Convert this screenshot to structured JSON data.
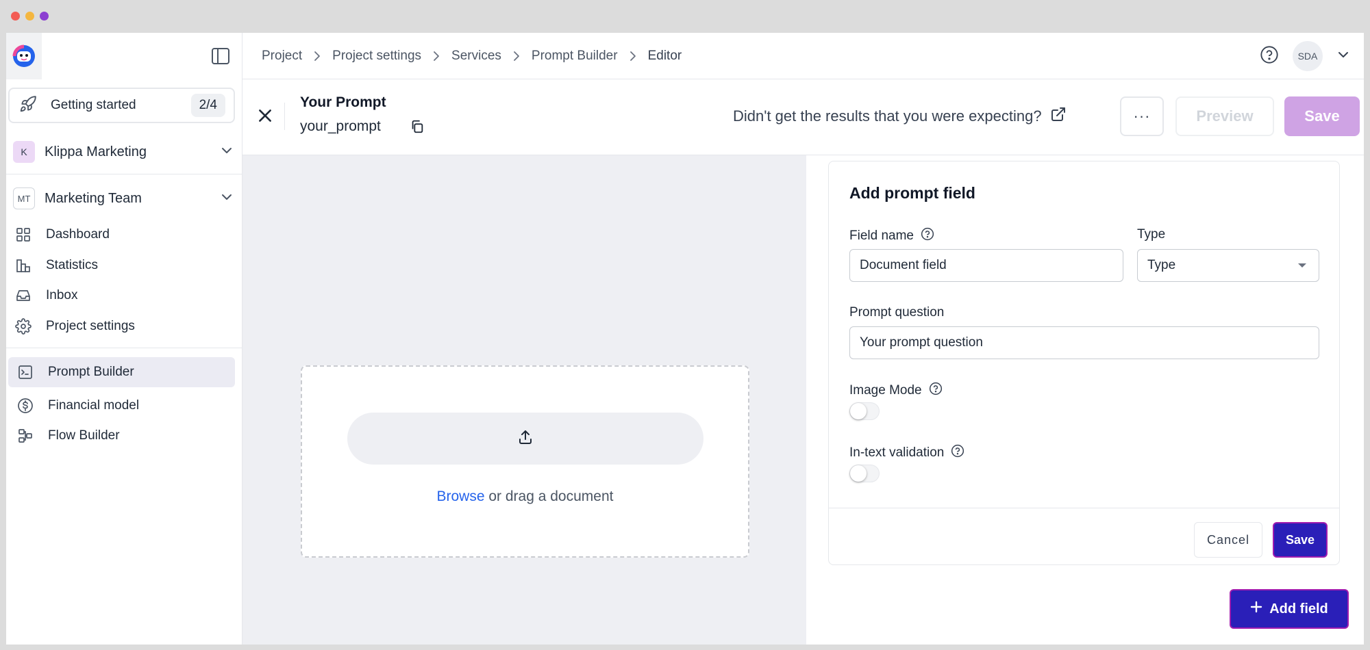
{
  "window": {
    "traffic_colors": [
      "#f25c54",
      "#f4b63f",
      "#8c3fd1"
    ]
  },
  "sidebar": {
    "getting_started": {
      "label": "Getting started",
      "progress": "2/4"
    },
    "organization": {
      "initial": "K",
      "name": "Klippa Marketing",
      "badge_color": "#e9d5f5"
    },
    "team": {
      "initial": "MT",
      "name": "Marketing Team"
    },
    "nav": [
      {
        "label": "Dashboard",
        "icon": "grid-icon"
      },
      {
        "label": "Statistics",
        "icon": "bar-chart-icon"
      },
      {
        "label": "Inbox",
        "icon": "inbox-icon"
      },
      {
        "label": "Project settings",
        "icon": "gear-icon"
      }
    ],
    "nav2": [
      {
        "label": "Prompt Builder",
        "icon": "terminal-icon",
        "active": true
      },
      {
        "label": "Financial model",
        "icon": "dollar-icon"
      },
      {
        "label": "Flow Builder",
        "icon": "flow-icon"
      }
    ]
  },
  "topbar": {
    "breadcrumb": [
      "Project",
      "Project settings",
      "Services",
      "Prompt Builder",
      "Editor"
    ],
    "avatar_initials": "SDA"
  },
  "editor": {
    "title": "Your Prompt",
    "slug": "your_prompt",
    "hint": "Didn't get the results that you were expecting?",
    "more_label": "···",
    "preview_label": "Preview",
    "save_label": "Save"
  },
  "dropzone": {
    "browse": "Browse",
    "text": " or drag a document"
  },
  "field_form": {
    "title": "Add prompt field",
    "field_name_label": "Field name",
    "field_name_value": "Document field",
    "type_label": "Type",
    "type_value": "Type",
    "prompt_question_label": "Prompt question",
    "prompt_question_value": "Your prompt question",
    "image_mode_label": "Image Mode",
    "image_mode_on": false,
    "intext_validation_label": "In-text validation",
    "intext_validation_on": false,
    "cancel_label": "Cancel",
    "save_label": "Save"
  },
  "add_field_label": "Add field",
  "colors": {
    "accent": "#2a1fb8",
    "accent_border": "#a21caf",
    "save_disabled": "#cfa3e4",
    "link": "#2563eb"
  }
}
